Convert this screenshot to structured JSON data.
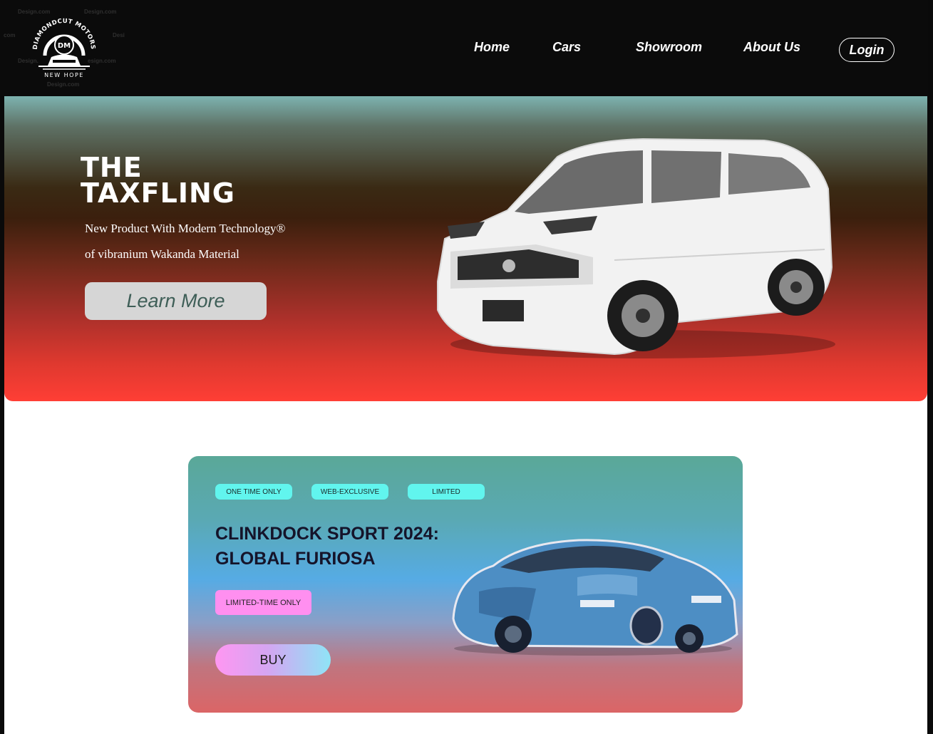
{
  "navbar": {
    "logo": {
      "brand_text": "DIAMONDCUT MOTORS",
      "monogram": "DM",
      "tagline": "NEW HOPE",
      "icon": "car-logo-icon"
    },
    "watermark": [
      "Design.com",
      "Design.com",
      "com",
      "Desi",
      "Design.",
      "esign.com",
      "Design.com"
    ],
    "links": [
      "Home",
      "Cars",
      "Showroom",
      "About Us"
    ],
    "login_label": "Login"
  },
  "hero": {
    "title_line1": "THE",
    "title_line2": "TAXFLING",
    "subtitle_line1": "New Product With Modern Technology®",
    "subtitle_line2": "of vibranium Wakanda Material",
    "cta_label": "Learn More",
    "image": "white-suv-image",
    "gradient_colors": [
      "#7db3b0",
      "#3b1f0d",
      "#ff3e35"
    ]
  },
  "promo": {
    "tags": [
      "ONE TIME ONLY",
      "WEB-EXCLUSIVE",
      "LIMITED"
    ],
    "title_line1": "CLINKDOCK SPORT 2024:",
    "title_line2": "GLOBAL FURIOSA",
    "badge": "LIMITED-TIME ONLY",
    "buy_label": "BUY",
    "image": "blue-sports-car-image",
    "tag_color": "#61f5ee",
    "badge_color": "#ff8ff0"
  }
}
